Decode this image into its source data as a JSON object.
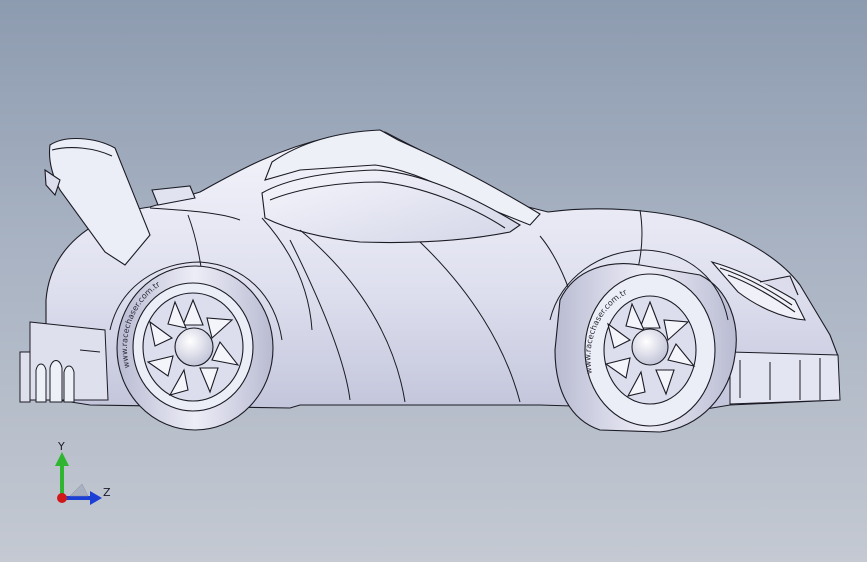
{
  "viewport": {
    "background_top": "#8d9bb0",
    "background_bottom": "#c4c9d2"
  },
  "model": {
    "body_fill": "#e6e7f3",
    "body_shade": "#c9cbe0",
    "edge_color": "#1b1b24",
    "watermark_text": "www.racechaser.com.tr"
  },
  "triad": {
    "y_label": "Y",
    "z_label": "Z",
    "y_color": "#2fb52f",
    "z_color": "#1c3fd6",
    "x_color": "#d01818"
  }
}
